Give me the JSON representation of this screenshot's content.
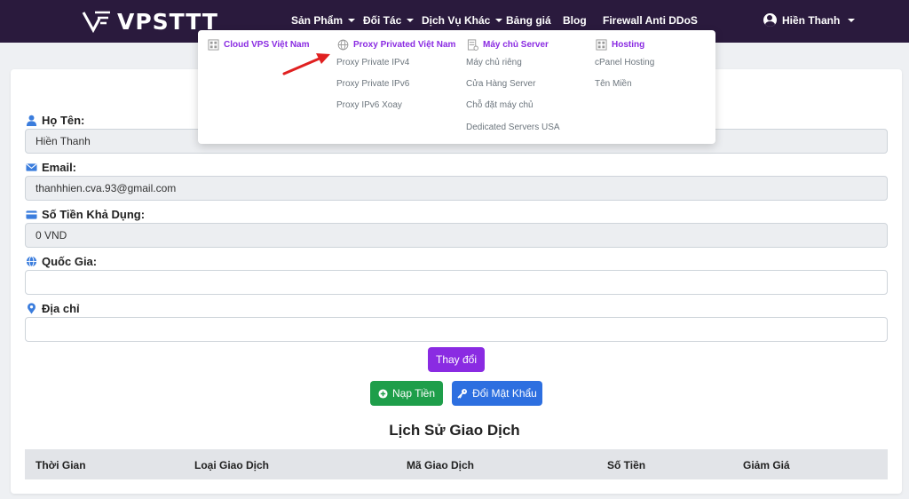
{
  "brand": {
    "name": "VPSTTT"
  },
  "nav": {
    "items": [
      {
        "label": "Sản Phẩm",
        "caret": true
      },
      {
        "label": "Đối Tác",
        "caret": true
      },
      {
        "label": "Dịch Vụ Khác",
        "caret": true
      },
      {
        "label": "Bảng giá",
        "caret": false
      },
      {
        "label": "Blog",
        "caret": false
      },
      {
        "label": "Firewall Anti DDoS",
        "caret": false
      }
    ],
    "user": "Hiền Thanh"
  },
  "mega_menu": {
    "columns": [
      {
        "title": "Cloud VPS Việt Nam",
        "icon": "grid-icon",
        "links": []
      },
      {
        "title": "Proxy Privated Việt Nam",
        "icon": "globe-icon",
        "links": [
          "Proxy Private IPv4",
          "Proxy Private IPv6",
          "Proxy IPv6 Xoay"
        ]
      },
      {
        "title": "Máy chủ Server",
        "icon": "server-icon",
        "links": [
          "Máy chủ riêng",
          "Cửa Hàng Server",
          "Chỗ đặt máy chủ",
          "Dedicated Servers USA"
        ]
      },
      {
        "title": "Hosting",
        "icon": "grid-icon",
        "links": [
          "cPanel Hosting",
          "Tên Miền"
        ]
      }
    ]
  },
  "profile": {
    "fields": [
      {
        "label": "Họ Tên:",
        "value": "Hiền Thanh",
        "readonly": true,
        "icon": "user-icon"
      },
      {
        "label": "Email:",
        "value": "thanhhien.cva.93@gmail.com",
        "readonly": true,
        "icon": "envelope-icon"
      },
      {
        "label": "Số Tiền Khả Dụng:",
        "value": "0 VND",
        "readonly": true,
        "icon": "wallet-icon"
      },
      {
        "label": "Quốc Gia:",
        "value": "",
        "readonly": false,
        "icon": "globe-icon"
      },
      {
        "label": "Địa chỉ",
        "value": "",
        "readonly": false,
        "icon": "map-pin-icon"
      }
    ],
    "update_button": "Thay đổi",
    "topup_button": "Nạp Tiền",
    "change_password_button": "Đổi Mật Khẩu"
  },
  "history": {
    "title": "Lịch Sử Giao Dịch",
    "columns": [
      "Thời Gian",
      "Loại Giao Dịch",
      "Mã Giao Dịch",
      "Số Tiền",
      "Giảm Giá"
    ]
  },
  "colors": {
    "topbar": "#2a1a3d",
    "accent_purple": "#8a2be2",
    "green": "#1e9e4a",
    "blue": "#2d6fe0",
    "icon_blue": "#3b7ddd",
    "annotation_arrow": "#e02020"
  }
}
